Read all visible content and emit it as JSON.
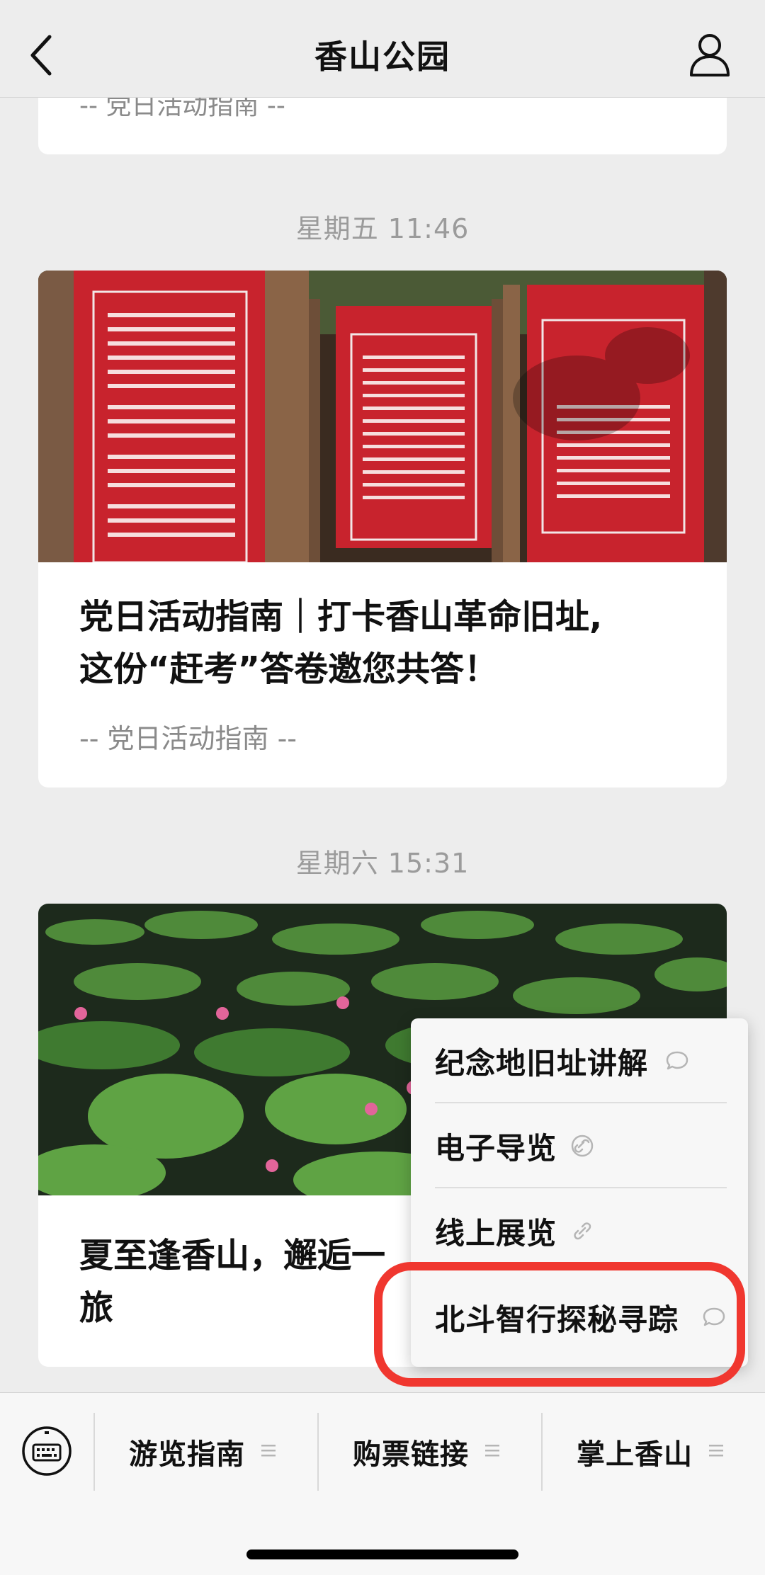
{
  "header": {
    "title": "香山公园",
    "back_icon": "chevron-left-icon",
    "profile_icon": "person-icon"
  },
  "feed": {
    "top_card_subtitle": "-- 党日活动指南 --",
    "articles": [
      {
        "time": "星期五 11:46",
        "title_line1": "党日活动指南｜打卡香山革命旧址,",
        "title_line2": "这份“赶考”答卷邀您共答！",
        "subtitle": "-- 党日活动指南 --"
      },
      {
        "time": "星期六 15:31",
        "title_line1": "夏至逢香山，邂逅一",
        "title_line2": "旅"
      }
    ]
  },
  "popup_menu": {
    "items": [
      {
        "label": "纪念地旧址讲解",
        "icon": "chat-bubble-icon"
      },
      {
        "label": "电子导览",
        "icon": "link-icon"
      },
      {
        "label": "线上展览",
        "icon": "link-icon"
      },
      {
        "label": "北斗智行探秘寻踪",
        "icon": "chat-bubble-icon"
      }
    ],
    "highlight_color": "#f0372f"
  },
  "bottom_bar": {
    "keyboard_icon": "keyboard-icon",
    "items": [
      {
        "label": "游览指南"
      },
      {
        "label": "购票链接"
      },
      {
        "label": "掌上香山"
      }
    ]
  }
}
